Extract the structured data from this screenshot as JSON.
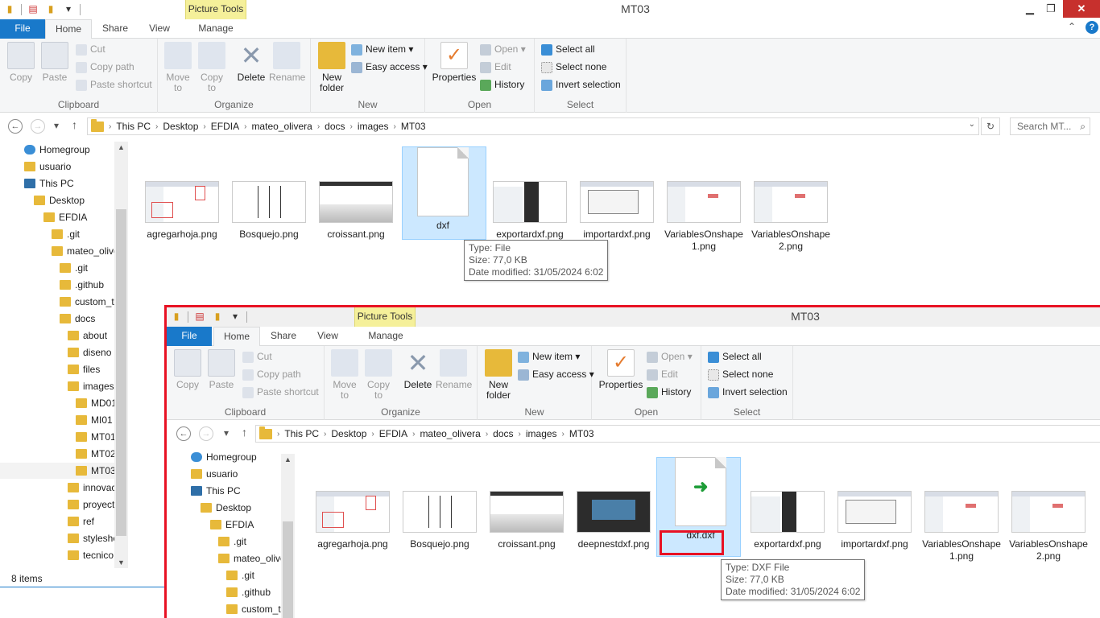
{
  "accent": "#1979ca",
  "highlight": "#e81123",
  "back_window": {
    "title": "MT03",
    "picture_tools": "Picture Tools",
    "tabs": [
      "File",
      "Home",
      "Share",
      "View",
      "Manage"
    ],
    "ribbon": {
      "clipboard": {
        "label": "Clipboard",
        "copy": "Copy",
        "paste": "Paste",
        "cut": "Cut",
        "copy_path": "Copy path",
        "paste_shortcut": "Paste shortcut"
      },
      "organize": {
        "label": "Organize",
        "move_to": "Move to",
        "copy_to": "Copy to",
        "delete": "Delete",
        "rename": "Rename"
      },
      "new": {
        "label": "New",
        "new_folder": "New folder",
        "new_item": "New item",
        "easy_access": "Easy access"
      },
      "open": {
        "label": "Open",
        "properties": "Properties",
        "open": "Open",
        "edit": "Edit",
        "history": "History"
      },
      "select": {
        "label": "Select",
        "select_all": "Select all",
        "select_none": "Select none",
        "invert": "Invert selection"
      }
    },
    "breadcrumb": [
      "This PC",
      "Desktop",
      "EFDIA",
      "mateo_olivera",
      "docs",
      "images",
      "MT03"
    ],
    "search_placeholder": "Search MT...",
    "nav_tree": [
      "Homegroup",
      "usuario",
      "This PC",
      "Desktop",
      "EFDIA",
      ".git",
      "mateo_olive",
      ".git",
      ".github",
      "custom_t",
      "docs",
      "about",
      "diseno",
      "files",
      "images",
      "MD01",
      "MI01",
      "MT01",
      "MT02",
      "MT03",
      "innovac",
      "proyect",
      "ref",
      "styleshe",
      "tecnico"
    ],
    "files": [
      "agregarhoja.png",
      "Bosquejo.png",
      "croissant.png",
      "dxf",
      "exportardxf.png",
      "importardxf.png",
      "VariablesOnshape1.png",
      "VariablesOnshape2.png"
    ],
    "tooltip": {
      "type": "Type: File",
      "size": "Size: 77,0 KB",
      "date": "Date modified: 31/05/2024 6:02"
    },
    "status": "8 items"
  },
  "front_window": {
    "title": "MT03",
    "picture_tools": "Picture Tools",
    "tabs": [
      "File",
      "Home",
      "Share",
      "View",
      "Manage"
    ],
    "breadcrumb": [
      "This PC",
      "Desktop",
      "EFDIA",
      "mateo_olivera",
      "docs",
      "images",
      "MT03"
    ],
    "nav_tree": [
      "Homegroup",
      "usuario",
      "This PC",
      "Desktop",
      "EFDIA",
      ".git",
      "mateo_olive",
      ".git",
      ".github",
      "custom_t"
    ],
    "files": [
      "agregarhoja.png",
      "Bosquejo.png",
      "croissant.png",
      "deepnestdxf.png",
      "dxf.dxf",
      "exportardxf.png",
      "importardxf.png",
      "VariablesOnshape1.png",
      "VariablesOnshape2.png"
    ],
    "tooltip": {
      "type": "Type: DXF File",
      "size": "Size: 77,0 KB",
      "date": "Date modified: 31/05/2024 6:02"
    }
  }
}
